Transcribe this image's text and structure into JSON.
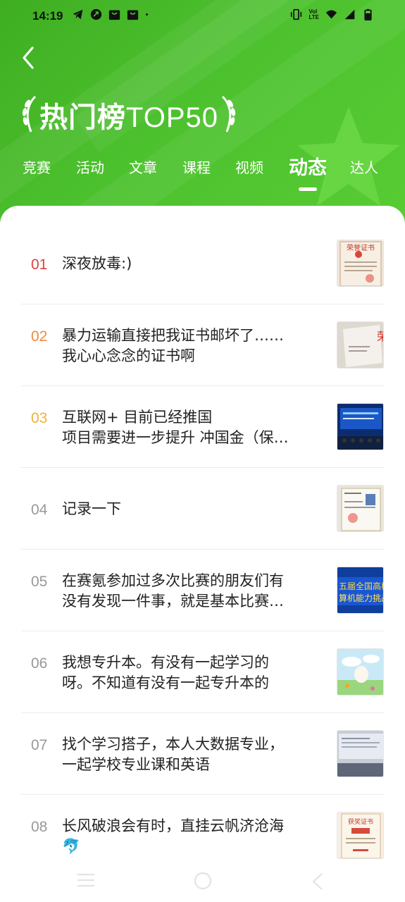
{
  "status_bar": {
    "time": "14:19",
    "left_icons": [
      "telegram-icon",
      "app-circle-icon",
      "shop-bag-icon",
      "shop-bag-icon",
      "dot-icon"
    ],
    "right_icons": [
      "vibrate-icon",
      "volte-icon",
      "wifi-icon",
      "signal-icon",
      "battery-icon"
    ],
    "volte_label_top": "Vol",
    "volte_label_bottom": "LTE"
  },
  "header": {
    "title_cn": "热门榜",
    "title_en": "TOP50",
    "accent_color": "#4cbb2b"
  },
  "tabs": [
    {
      "label": "竞赛",
      "active": false
    },
    {
      "label": "活动",
      "active": false
    },
    {
      "label": "文章",
      "active": false
    },
    {
      "label": "课程",
      "active": false
    },
    {
      "label": "视频",
      "active": false
    },
    {
      "label": "动态",
      "active": true
    },
    {
      "label": "达人",
      "active": false
    }
  ],
  "rank_colors": {
    "r1": "#e04040",
    "r2": "#ef8a3c",
    "r3": "#f0b23a",
    "other": "#999999"
  },
  "items": [
    {
      "rank": "01",
      "lines": [
        "深夜放毒:)"
      ]
    },
    {
      "rank": "02",
      "lines": [
        "暴力运输直接把我证书邮坏了……",
        "我心心念念的证书啊"
      ]
    },
    {
      "rank": "03",
      "lines": [
        "互联网+ 目前已经推国",
        "项目需要进一步提升 冲国金（保…"
      ]
    },
    {
      "rank": "04",
      "lines": [
        "记录一下"
      ]
    },
    {
      "rank": "05",
      "lines": [
        "在赛氪参加过多次比赛的朋友们有",
        "没有发现一件事，就是基本比赛…"
      ]
    },
    {
      "rank": "06",
      "lines": [
        "我想专升本。有没有一起学习的",
        "呀。不知道有没有一起专升本的"
      ]
    },
    {
      "rank": "07",
      "lines": [
        "找个学习搭子，本人大数据专业，",
        "一起学校专业课和英语"
      ]
    },
    {
      "rank": "08",
      "lines": [
        "长风破浪会有时，直挂云帆济沧海",
        "🐬"
      ]
    }
  ],
  "thumb_texts": {
    "t1": "荣誉证书",
    "t2": "荣",
    "t5a": "五届全国高校",
    "t5b": "算机能力挑战",
    "t8": "获奖证书"
  },
  "nav": [
    "menu-icon",
    "home-circle-icon",
    "back-triangle-icon"
  ]
}
